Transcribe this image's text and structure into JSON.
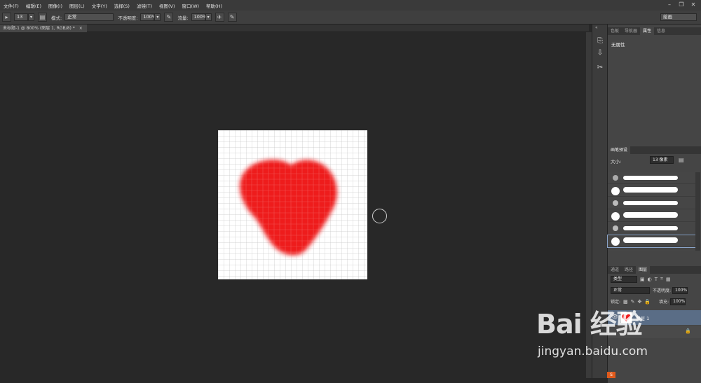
{
  "menu": [
    "文件(F)",
    "编辑(E)",
    "图像(I)",
    "图层(L)",
    "文字(Y)",
    "选择(S)",
    "滤镜(T)",
    "视图(V)",
    "窗口(W)",
    "帮助(H)"
  ],
  "options": {
    "brush_size": "13",
    "mode_label": "模式:",
    "mode_value": "正常",
    "opacity_label": "不透明度:",
    "opacity_value": "100%",
    "flow_label": "流量:",
    "flow_value": "100%",
    "workspace": "绘画"
  },
  "document_tab": "未标题-1 @ 800% (图层 1, RGB/8) *",
  "properties_panel": {
    "tabs": [
      "色板",
      "导航器",
      "属性",
      "信息"
    ],
    "active_tab": "属性",
    "content": "无属性"
  },
  "brush_presets": {
    "tab": "画笔预设",
    "size_label": "大小:",
    "size_value": "13 像素"
  },
  "layers_panel": {
    "tabs": [
      "通道",
      "路径",
      "图层"
    ],
    "active_tab": "图层",
    "filter_kind": "类型",
    "blend_mode": "正常",
    "opacity_label": "不透明度:",
    "opacity_value": "100%",
    "lock_label": "锁定:",
    "fill_label": "填充:",
    "fill_value": "100%",
    "layers": [
      {
        "name": "图层 1",
        "visible": true
      }
    ]
  },
  "canvas": {
    "zoom": "800%",
    "heart_color": "#ee1d1d"
  },
  "watermark": {
    "logo": "Bai 经验",
    "url": "jingyan.baidu.com"
  }
}
